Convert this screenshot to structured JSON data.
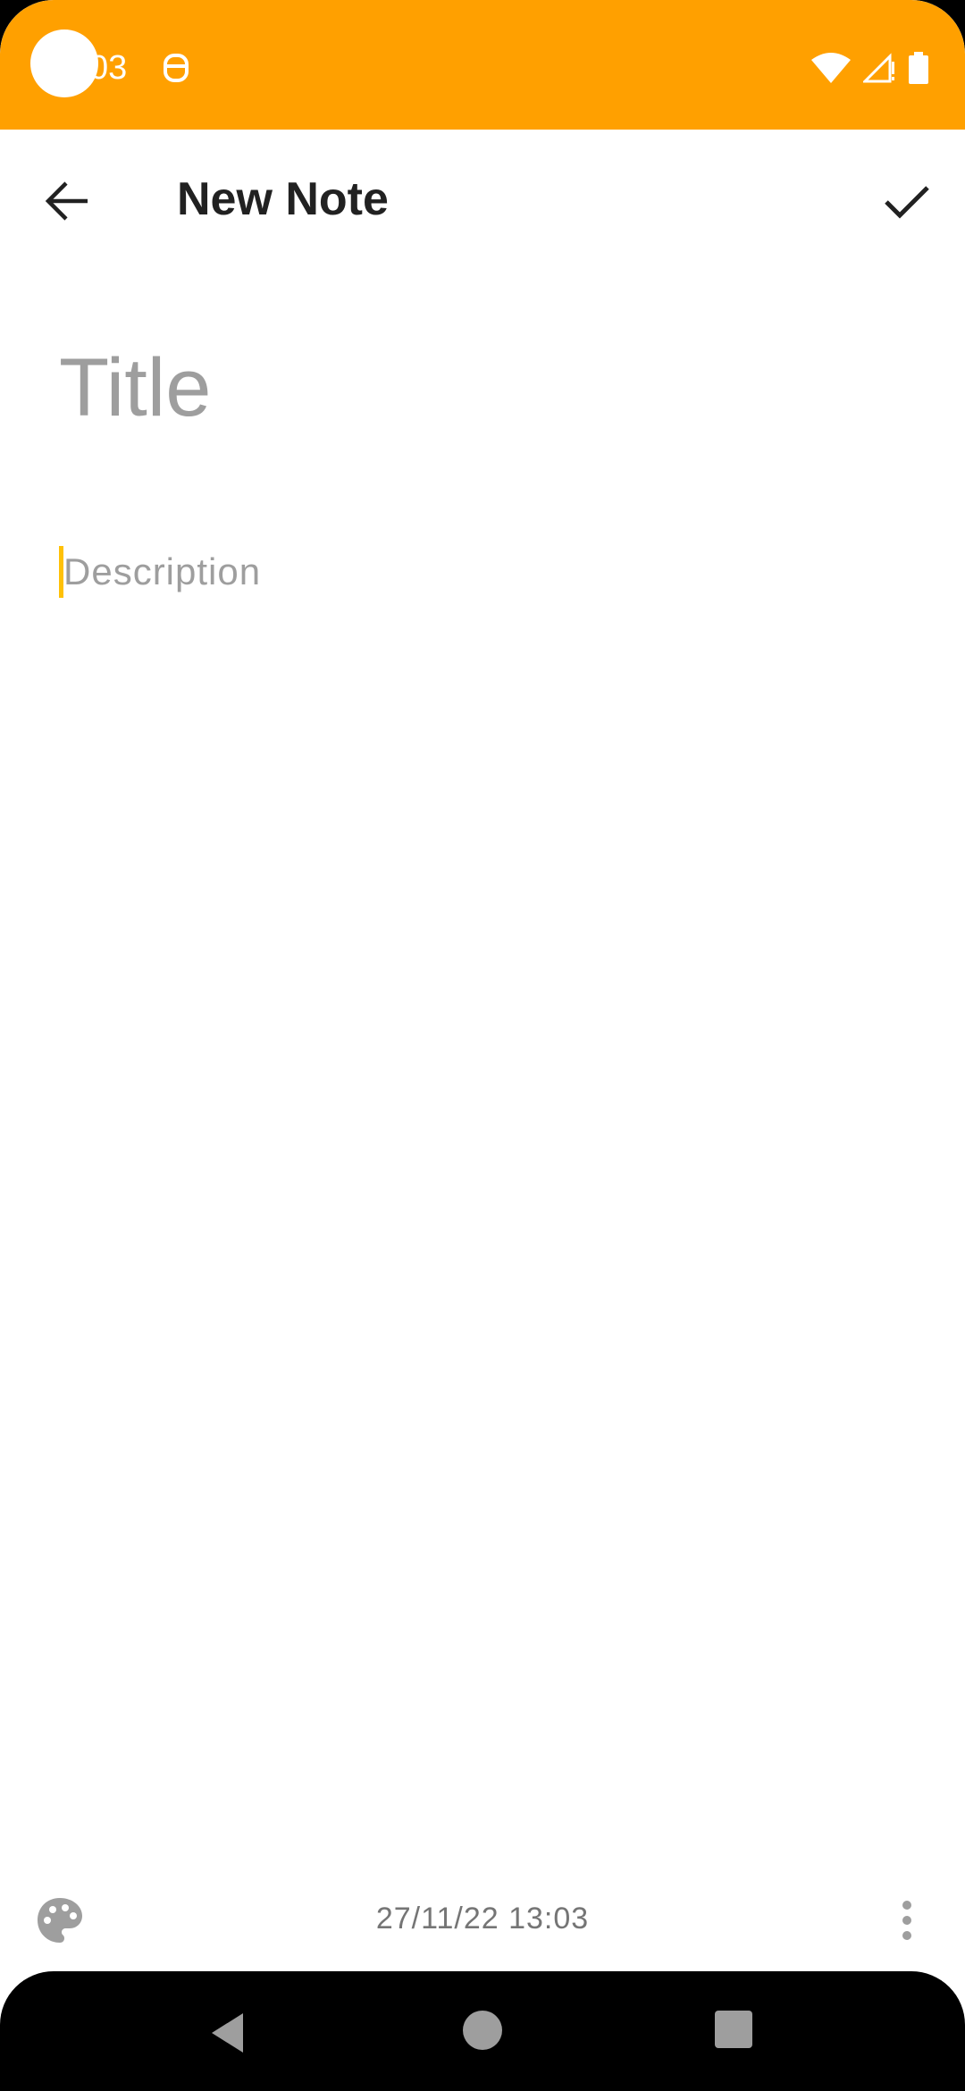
{
  "status_bar": {
    "time": "03",
    "background_color": "#FFA000",
    "icons": [
      "notification-face-icon",
      "wifi-icon",
      "signal-icon",
      "battery-icon"
    ]
  },
  "app_bar": {
    "title": "New Note",
    "back_icon": "arrow-back-icon",
    "save_icon": "check-icon"
  },
  "editor": {
    "title_placeholder": "Title",
    "description_placeholder": "Description",
    "cursor_color": "#FFC107"
  },
  "bottom_bar": {
    "palette_icon": "palette-icon",
    "date": "27/11/22 13:03",
    "more_icon": "more-vert-icon"
  },
  "nav_bar": {
    "buttons": [
      "nav-back-icon",
      "nav-home-icon",
      "nav-recents-icon"
    ]
  }
}
